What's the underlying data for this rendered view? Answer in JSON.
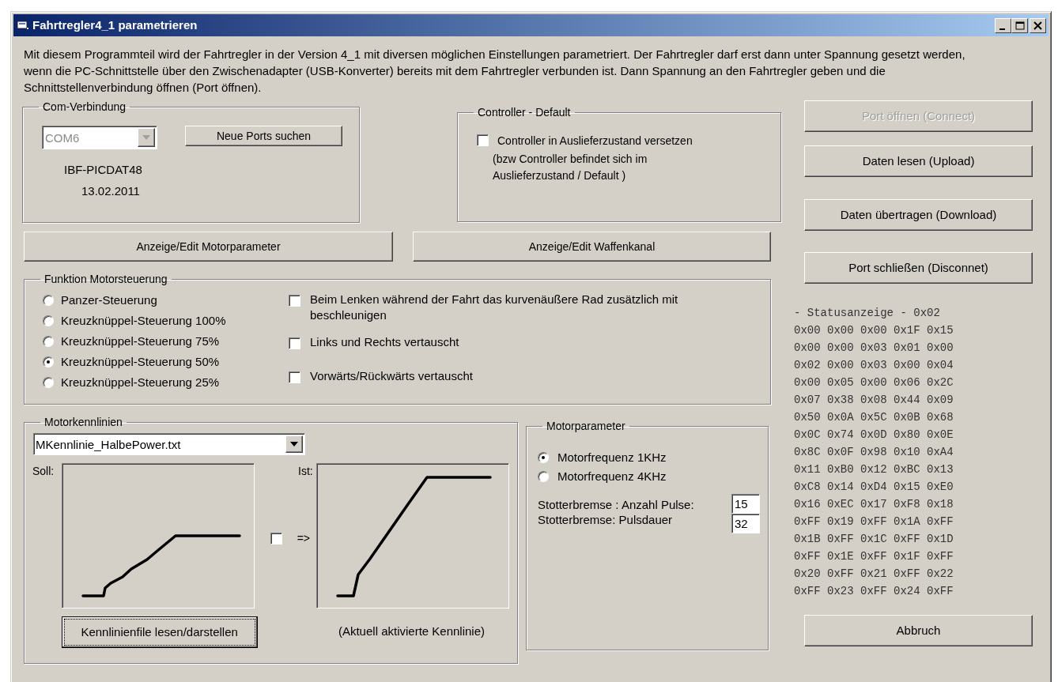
{
  "window": {
    "title": "Fahrtregler4_1 parametrieren"
  },
  "intro": "Mit diesem Programmteil wird der Fahrtregler in der Version 4_1 mit diversen möglichen Einstellungen parametriert. Der Fahrtregler darf erst dann unter Spannung gesetzt werden, wenn die PC-Schnittstelle über den Zwischenadapter (USB-Konverter) bereits mit dem Fahrtregler verbunden ist. Dann Spannung an den Fahrtregler geben und die Schnittstellenverbindung öffnen  (Port öffnen).",
  "com": {
    "title": "Com-Verbindung",
    "port": {
      "value": "COM6",
      "disabled": true
    },
    "search_button": "Neue Ports suchen",
    "device": "IBF-PICDAT48",
    "date": "13.02.2011"
  },
  "controller_default": {
    "title": "Controller - Default",
    "checkbox": {
      "label": "Controller in Auslieferzustand versetzen",
      "checked": false
    },
    "note": "(bzw Controller befindet sich im Auslieferzustand / Default )"
  },
  "edit_buttons": [
    "Anzeige/Edit Motorparameter",
    "Anzeige/Edit Waffenkanal"
  ],
  "motor_control": {
    "title": "Funktion Motorsteuerung",
    "modes": [
      {
        "label": "Panzer-Steuerung",
        "selected": false
      },
      {
        "label": "Kreuzknüppel-Steuerung 100%",
        "selected": false
      },
      {
        "label": "Kreuzknüppel-Steuerung 75%",
        "selected": false
      },
      {
        "label": "Kreuzknüppel-Steuerung 50%",
        "selected": true
      },
      {
        "label": "Kreuzknüppel-Steuerung 25%",
        "selected": false
      }
    ],
    "options": [
      {
        "label": "Beim Lenken während der Fahrt das kurvenäußere Rad zusätzlich mit beschleunigen",
        "checked": false
      },
      {
        "label": "Links und Rechts vertauscht",
        "checked": false
      },
      {
        "label": "Vorwärts/Rückwärts  vertauscht",
        "checked": false
      }
    ]
  },
  "curves": {
    "title": "Motorkennlinien",
    "file": "MKennlinie_HalbePower.txt",
    "target_label": "Soll:",
    "actual_label": "Ist:",
    "apply": {
      "checked": false
    },
    "arrow": "=>",
    "read_button": {
      "label": "Kennlinienfile lesen/darstellen",
      "focused": true
    },
    "caption": "(Aktuell aktivierte Kennlinie)"
  },
  "motor_params": {
    "title": "Motorparameter",
    "frequencies": [
      {
        "label": "Motorfrequenz 1KHz",
        "selected": true
      },
      {
        "label": "Motorfrequenz 4KHz",
        "selected": false
      }
    ],
    "fields": [
      {
        "label": "Stotterbremse : Anzahl Pulse:",
        "value": "15"
      },
      {
        "label": "Stotterbremse: Pulsdauer",
        "value": "32"
      }
    ]
  },
  "actions": [
    {
      "label": "Port öffnen (Connect)",
      "disabled": true
    },
    {
      "label": "Daten lesen (Upload)",
      "disabled": false
    },
    {
      "label": "Daten übertragen (Download)",
      "disabled": false
    },
    {
      "label": "Port schließen (Disconnet)",
      "disabled": false
    }
  ],
  "status": {
    "title": "- Statusanzeige - 0x02",
    "rows": [
      "0x00 0x00 0x00 0x1F 0x15",
      "0x00 0x00 0x03 0x01 0x00",
      "0x02 0x00 0x03 0x00 0x04",
      "0x00 0x05 0x00 0x06 0x2C",
      "0x07 0x38 0x08 0x44 0x09",
      "0x50 0x0A 0x5C 0x0B 0x68",
      "0x0C 0x74 0x0D 0x80 0x0E",
      "0x8C 0x0F 0x98 0x10 0xA4",
      "0x11 0xB0 0x12 0xBC 0x13",
      "0xC8 0x14 0xD4 0x15 0xE0",
      "0x16 0xEC 0x17 0xF8 0x18",
      "0xFF 0x19 0xFF 0x1A 0xFF",
      "0x1B 0xFF 0x1C 0xFF 0x1D",
      "0xFF 0x1E 0xFF 0x1F 0xFF",
      "0x20 0xFF 0x21 0xFF 0x22",
      "0xFF 0x23 0xFF 0x24 0xFF"
    ]
  },
  "cancel_button": "Abbruch"
}
